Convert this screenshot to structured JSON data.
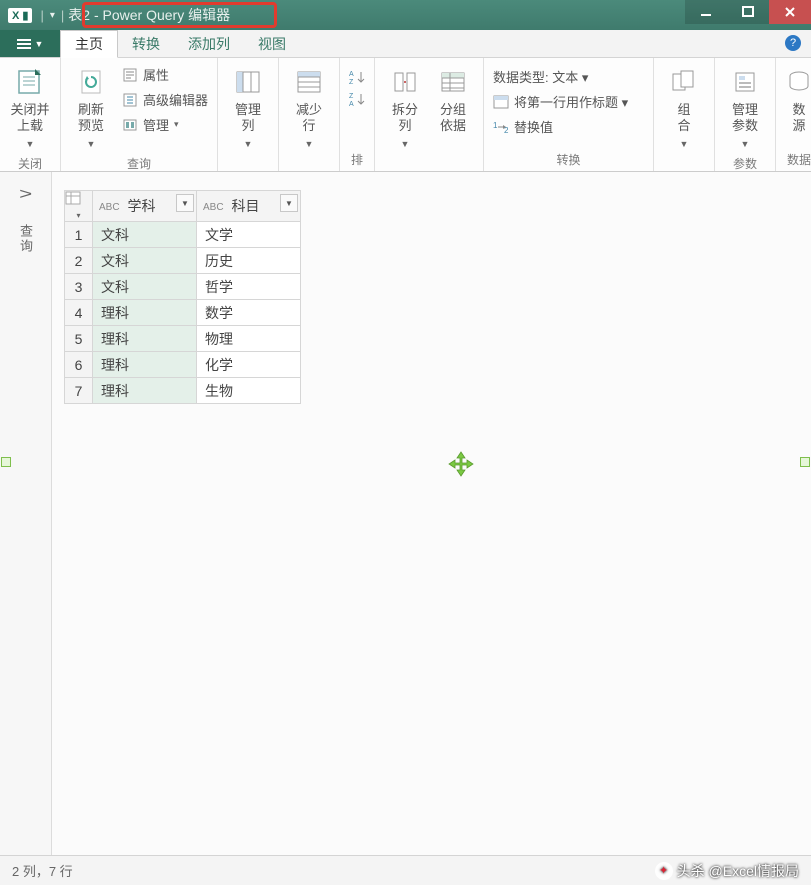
{
  "window": {
    "app_badge": "X ▮",
    "title": "表2 - Power Query 编辑器"
  },
  "menubar": {
    "file_glyph": "≡ ▾",
    "tabs": [
      "主页",
      "转换",
      "添加列",
      "视图"
    ],
    "active_tab_index": 0
  },
  "ribbon": {
    "groups": {
      "close": {
        "label": "关闭",
        "close_load": "关闭并\n上载"
      },
      "query": {
        "label": "查询",
        "refresh": "刷新\n预览",
        "props": "属性",
        "adv_editor": "高级编辑器",
        "manage": "管理"
      },
      "manage_cols": {
        "label": "",
        "cols": "管理\n列"
      },
      "reduce_rows": {
        "label": "",
        "rows": "减少\n行"
      },
      "sort": {
        "label": "排",
        "az": "A→Z",
        "za": "Z→A"
      },
      "split": {
        "label": "",
        "split_col": "拆分\n列",
        "group_by": "分组\n依据"
      },
      "transform": {
        "label": "转换",
        "data_type": "数据类型: 文本 ▾",
        "first_row_header": "将第一行用作标题 ▾",
        "replace": "替换值"
      },
      "combine": {
        "label": "",
        "combine": "组\n合"
      },
      "params": {
        "label": "参数",
        "manage_params": "管理\n参数"
      },
      "data_source": {
        "label": "数据",
        "source": "数\n源"
      }
    }
  },
  "side_panel": {
    "chevron": ">",
    "label": "查询"
  },
  "table": {
    "columns": [
      {
        "type": "ABC",
        "name": "学科"
      },
      {
        "type": "ABC",
        "name": "科目"
      }
    ],
    "rows": [
      {
        "n": "1",
        "c0": "文科",
        "c1": "文学"
      },
      {
        "n": "2",
        "c0": "文科",
        "c1": "历史"
      },
      {
        "n": "3",
        "c0": "文科",
        "c1": "哲学"
      },
      {
        "n": "4",
        "c0": "理科",
        "c1": "数学"
      },
      {
        "n": "5",
        "c0": "理科",
        "c1": "物理"
      },
      {
        "n": "6",
        "c0": "理科",
        "c1": "化学"
      },
      {
        "n": "7",
        "c0": "理科",
        "c1": "生物"
      }
    ]
  },
  "statusbar": {
    "text": "2 列，7 行"
  },
  "watermark": {
    "text": "头杀 @Excel情报局"
  }
}
